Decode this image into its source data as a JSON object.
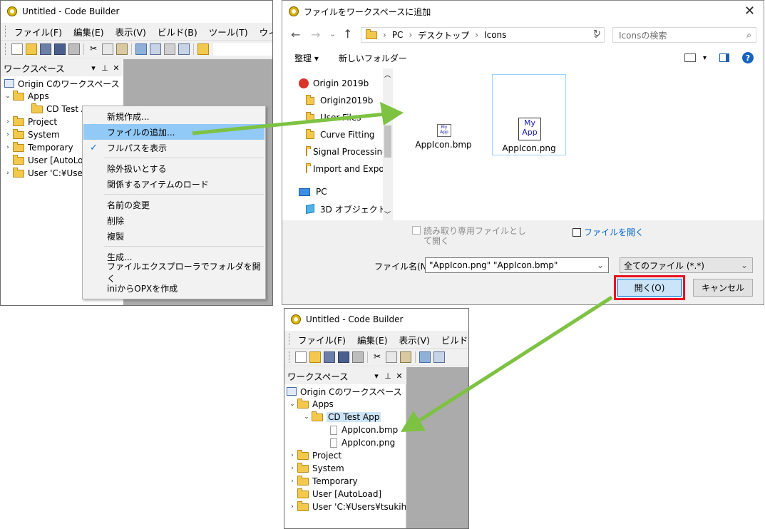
{
  "window_top": {
    "title": "Untitled - Code Builder",
    "menu": [
      "ファイル(F)",
      "編集(E)",
      "表示(V)",
      "ビルド(B)",
      "ツール(T)",
      "ウィンドウ(W)"
    ],
    "workspace_title": "ワークスペース",
    "tree": {
      "root": "Origin Cのワークスペース",
      "apps": "Apps",
      "cd_test": "CD Test A",
      "project": "Project",
      "system": "System",
      "temporary": "Temporary",
      "user_autoload": "User  [AutoLo",
      "user_path": "User 'C:¥User"
    }
  },
  "context_menu": {
    "items": [
      "新規作成...",
      "ファイルの追加...",
      "フルパスを表示",
      "除外扱いとする",
      "関係するアイテムのロード",
      "名前の変更",
      "削除",
      "複製",
      "生成...",
      "ファイルエクスプローラでフォルダを開く",
      "iniからOPXを作成"
    ],
    "check_mark": "✓"
  },
  "dialog": {
    "title": "ファイルをワークスペースに追加",
    "breadcrumb": [
      "PC",
      "デスクトップ",
      "Icons"
    ],
    "search_placeholder": "Iconsの検索",
    "organize": "整理 ▾",
    "new_folder": "新しいフォルダー",
    "nav_items": [
      "Origin 2019b",
      "Origin2019b",
      "User Files",
      "Curve Fitting",
      "Signal Processing",
      "Import and Export",
      "PC",
      "3D オブジェクト"
    ],
    "files": [
      {
        "name": "AppIcon.bmp",
        "thumb": [
          "My",
          "App"
        ]
      },
      {
        "name": "AppIcon.png",
        "thumb": [
          "My",
          "App"
        ]
      }
    ],
    "readonly_label": "読み取り専用ファイルとして開く",
    "readonly_line1": "読み取り専用ファイルとし",
    "readonly_line2": "て開く",
    "open_file_label": "ファイルを開く",
    "filename_label": "ファイル名(N):",
    "filename_value": "\"AppIcon.png\" \"AppIcon.bmp\"",
    "filetype_value": "全てのファイル (*.*)",
    "open_button": "開く(O)",
    "cancel_button": "キャンセル"
  },
  "window_bottom": {
    "title": "Untitled - Code Builder",
    "menu": [
      "ファイル(F)",
      "編集(E)",
      "表示(V)",
      "ビルド(B)"
    ],
    "workspace_title": "ワークスペース",
    "tree": {
      "root": "Origin Cのワークスペース",
      "apps": "Apps",
      "cd_test": "CD Test App",
      "file_bmp": "AppIcon.bmp",
      "file_png": "AppIcon.png",
      "project": "Project",
      "system": "System",
      "temporary": "Temporary",
      "user_autoload": "User  [AutoLoad]",
      "user_path": "User 'C:¥Users¥tsukihash"
    }
  },
  "colors": {
    "arrow": "#7dc242",
    "highlight": "#91c9f7",
    "red_frame": "#e81123",
    "link": "#0066cc"
  }
}
